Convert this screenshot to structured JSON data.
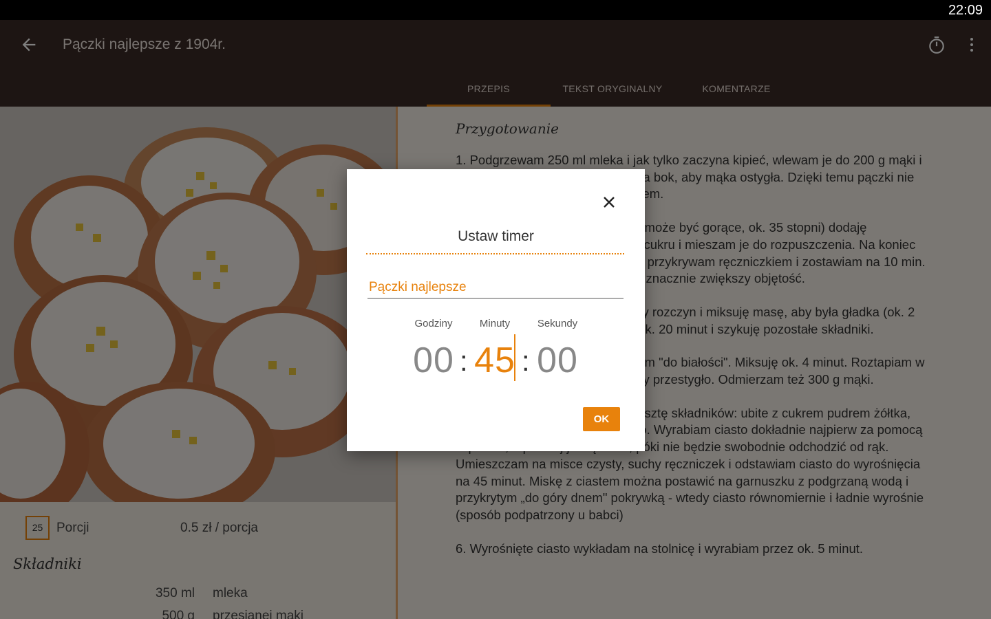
{
  "status_bar": {
    "time": "22:09"
  },
  "app_bar": {
    "title": "Pączki najlepsze z 1904r.",
    "back_icon": "arrow-left-icon",
    "timer_icon": "stopwatch-icon",
    "menu_icon": "more-vert-icon"
  },
  "tabs": [
    {
      "label": "PRZEPIS",
      "active": true
    },
    {
      "label": "TEKST ORYGINALNY",
      "active": false
    },
    {
      "label": "KOMENTARZE",
      "active": false
    }
  ],
  "recipe": {
    "portions": "25",
    "portions_label": "Porcji",
    "cost": "0.5 zł / porcja",
    "ingredients_heading": "Składniki",
    "ingredients": [
      {
        "amount": "350 ml",
        "name": "mleka"
      },
      {
        "amount": "500 g",
        "name": "przesianej mąki"
      }
    ],
    "preparation_heading": "Przygotowanie",
    "steps": [
      "1. Podgrzewam 250 ml mleka i jak tylko zaczyna kipieć, wlewam je do 200 g mąki i wszystko mieszam. Odstawiam na bok, aby mąka ostygła. Dzięki temu pączki nie będą tak mocno nasiąkać tłuszczem.",
      "2. Do 100 ml ciepłego mleka (nie może być gorące, ok. 35 stopni) dodaję rozkruszone drożdże, 1 łyżeczkę cukru i mieszam je do rozpuszczenia. Na koniec zasypuję łyżką mąki (tą co mam), przykrywam ręczniczkiem i zostawiam na 10 min. W tym czasie zacznie pracować i znacznie zwiększy objętość.",
      "3. Do ostygłej mąki dodaję gotowy rozczyn i miksuję masę, aby była gładka (ok. 2 minut). Zostawiam tak ciasto na ok. 20 minut i szykuję pozostałe składniki.",
      "4. Żółtka ucieram z cukrem pudrem \"do białości\". Miksuję ok. 4 minut. Roztapiam w rondelku masło i zostawiam je aby przestygło. Odmierzam też 300 g mąki.",
      "5. Do masy drożdżowej dodaję resztę składników: ubite z cukrem pudrem żółtka, resztę mąki i rozpuszczone masło. Wyrabiam ciasto dokładnie najpierw za pomocą szpatułki, a później już rękoma, póki nie będzie swobodnie odchodzić od rąk. Umieszczam na misce czysty, suchy ręczniczek i odstawiam ciasto do wyrośnięcia na 45 minut. Miskę z ciastem można postawić na garnuszku z podgrzaną wodą i przykrytym „do góry dnem\" pokrywką - wtedy ciasto równomiernie i ładnie wyrośnie (sposób podpatrzony u babci)",
      "6. Wyrośnięte ciasto wykładam na stolnicę i wyrabiam przez ok. 5 minut."
    ]
  },
  "timer_dialog": {
    "title": "Ustaw timer",
    "name_value": "Pączki najlepsze",
    "hours_label": "Godziny",
    "minutes_label": "Minuty",
    "seconds_label": "Sekundy",
    "hours": "00",
    "minutes": "45",
    "seconds": "00",
    "ok_label": "OK",
    "close_icon": "close-icon",
    "accent": "#e8820c"
  }
}
